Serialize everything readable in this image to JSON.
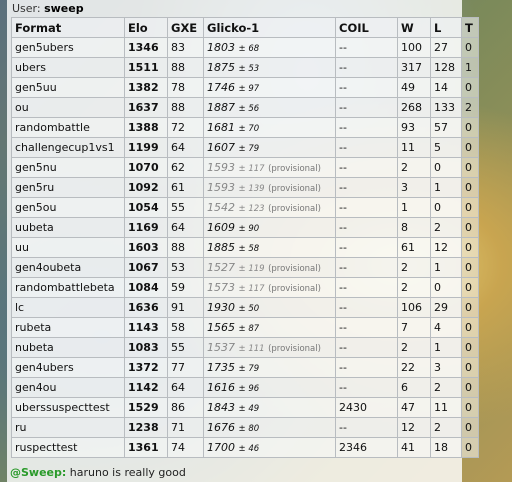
{
  "user": {
    "label": "User:",
    "name": "sweep"
  },
  "columns": [
    "Format",
    "Elo",
    "GXE",
    "Glicko-1",
    "COIL",
    "W",
    "L",
    "T"
  ],
  "rows": [
    {
      "format": "gen5ubers",
      "elo": "1346",
      "gxe": "83",
      "glicko": "1803",
      "dev": "± 68",
      "provisional": "",
      "coil": "--",
      "w": "100",
      "l": "27",
      "t": "0"
    },
    {
      "format": "ubers",
      "elo": "1511",
      "gxe": "88",
      "glicko": "1875",
      "dev": "± 53",
      "provisional": "",
      "coil": "--",
      "w": "317",
      "l": "128",
      "t": "1"
    },
    {
      "format": "gen5uu",
      "elo": "1382",
      "gxe": "78",
      "glicko": "1746",
      "dev": "± 97",
      "provisional": "",
      "coil": "--",
      "w": "49",
      "l": "14",
      "t": "0"
    },
    {
      "format": "ou",
      "elo": "1637",
      "gxe": "88",
      "glicko": "1887",
      "dev": "± 56",
      "provisional": "",
      "coil": "--",
      "w": "268",
      "l": "133",
      "t": "2"
    },
    {
      "format": "randombattle",
      "elo": "1388",
      "gxe": "72",
      "glicko": "1681",
      "dev": "± 70",
      "provisional": "",
      "coil": "--",
      "w": "93",
      "l": "57",
      "t": "0"
    },
    {
      "format": "challengecup1vs1",
      "elo": "1199",
      "gxe": "64",
      "glicko": "1607",
      "dev": "± 79",
      "provisional": "",
      "coil": "--",
      "w": "11",
      "l": "5",
      "t": "0"
    },
    {
      "format": "gen5nu",
      "elo": "1070",
      "gxe": "62",
      "glicko": "1593",
      "dev": "± 117",
      "provisional": "(provisional)",
      "coil": "--",
      "w": "2",
      "l": "0",
      "t": "0"
    },
    {
      "format": "gen5ru",
      "elo": "1092",
      "gxe": "61",
      "glicko": "1593",
      "dev": "± 139",
      "provisional": "(provisional)",
      "coil": "--",
      "w": "3",
      "l": "1",
      "t": "0"
    },
    {
      "format": "gen5ou",
      "elo": "1054",
      "gxe": "55",
      "glicko": "1542",
      "dev": "± 123",
      "provisional": "(provisional)",
      "coil": "--",
      "w": "1",
      "l": "0",
      "t": "0"
    },
    {
      "format": "uubeta",
      "elo": "1169",
      "gxe": "64",
      "glicko": "1609",
      "dev": "± 90",
      "provisional": "",
      "coil": "--",
      "w": "8",
      "l": "2",
      "t": "0"
    },
    {
      "format": "uu",
      "elo": "1603",
      "gxe": "88",
      "glicko": "1885",
      "dev": "± 58",
      "provisional": "",
      "coil": "--",
      "w": "61",
      "l": "12",
      "t": "0"
    },
    {
      "format": "gen4oubeta",
      "elo": "1067",
      "gxe": "53",
      "glicko": "1527",
      "dev": "± 119",
      "provisional": "(provisional)",
      "coil": "--",
      "w": "2",
      "l": "1",
      "t": "0"
    },
    {
      "format": "randombattlebeta",
      "elo": "1084",
      "gxe": "59",
      "glicko": "1573",
      "dev": "± 117",
      "provisional": "(provisional)",
      "coil": "--",
      "w": "2",
      "l": "0",
      "t": "0"
    },
    {
      "format": "lc",
      "elo": "1636",
      "gxe": "91",
      "glicko": "1930",
      "dev": "± 50",
      "provisional": "",
      "coil": "--",
      "w": "106",
      "l": "29",
      "t": "0"
    },
    {
      "format": "rubeta",
      "elo": "1143",
      "gxe": "58",
      "glicko": "1565",
      "dev": "± 87",
      "provisional": "",
      "coil": "--",
      "w": "7",
      "l": "4",
      "t": "0"
    },
    {
      "format": "nubeta",
      "elo": "1083",
      "gxe": "55",
      "glicko": "1537",
      "dev": "± 111",
      "provisional": "(provisional)",
      "coil": "--",
      "w": "2",
      "l": "1",
      "t": "0"
    },
    {
      "format": "gen4ubers",
      "elo": "1372",
      "gxe": "77",
      "glicko": "1735",
      "dev": "± 79",
      "provisional": "",
      "coil": "--",
      "w": "22",
      "l": "3",
      "t": "0"
    },
    {
      "format": "gen4ou",
      "elo": "1142",
      "gxe": "64",
      "glicko": "1616",
      "dev": "± 96",
      "provisional": "",
      "coil": "--",
      "w": "6",
      "l": "2",
      "t": "0"
    },
    {
      "format": "uberssuspecttest",
      "elo": "1529",
      "gxe": "86",
      "glicko": "1843",
      "dev": "± 49",
      "provisional": "",
      "coil": "2430",
      "w": "47",
      "l": "11",
      "t": "0"
    },
    {
      "format": "ru",
      "elo": "1238",
      "gxe": "71",
      "glicko": "1676",
      "dev": "± 80",
      "provisional": "",
      "coil": "--",
      "w": "12",
      "l": "2",
      "t": "0"
    },
    {
      "format": "ruspecttest",
      "elo": "1361",
      "gxe": "74",
      "glicko": "1700",
      "dev": "± 46",
      "provisional": "",
      "coil": "2346",
      "w": "41",
      "l": "18",
      "t": "0"
    }
  ],
  "chat": {
    "prefix": "@",
    "name": "Sweep:",
    "message": "haruno is really good"
  }
}
